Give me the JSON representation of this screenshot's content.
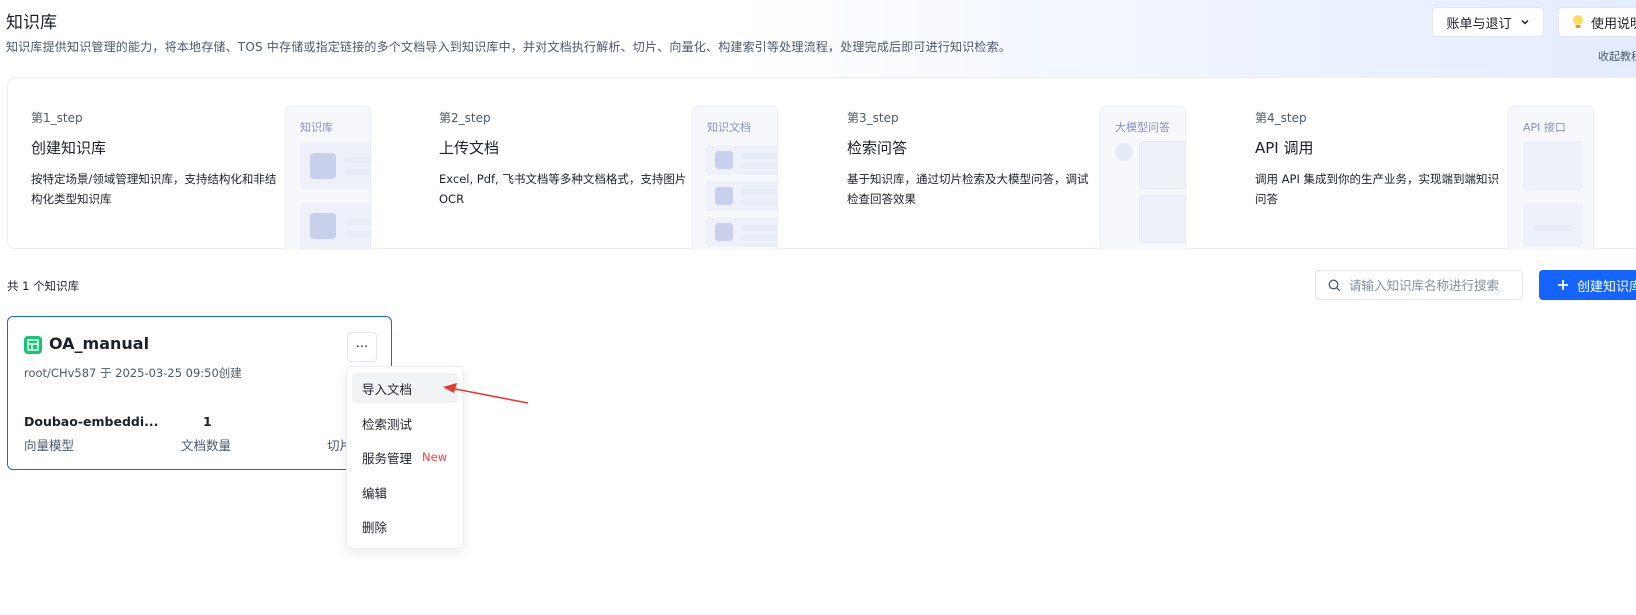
{
  "header": {
    "title": "知识库",
    "description": "知识库提供知识管理的能力，将本地存储、TOS 中存储或指定链接的多个文档导入到知识库中，并对文档执行解析、切片、向量化、构建索引等处理流程，处理完成后即可进行知识检索。",
    "billing_button": "账单与退订",
    "guide_button": "使用说明",
    "collapse_link": "收起教程"
  },
  "steps": [
    {
      "no": "第1_step",
      "title": "创建知识库",
      "desc": "按特定场景/领域管理知识库，支持结构化和非结构化类型知识库",
      "illus_label": "知识库"
    },
    {
      "no": "第2_step",
      "title": "上传文档",
      "desc": "Excel, Pdf, 飞书文档等多种文档格式，支持图片 OCR",
      "illus_label": "知识文档"
    },
    {
      "no": "第3_step",
      "title": "检索问答",
      "desc": "基于知识库，通过切片检索及大模型问答，调试检查回答效果",
      "illus_label": "大模型问答"
    },
    {
      "no": "第4_step",
      "title": "API 调用",
      "desc": "调用 API 集成到你的生产业务，实现端到端知识问答",
      "illus_label": "API 接口"
    }
  ],
  "list": {
    "count_text": "共 1 个知识库",
    "search_placeholder": "请输入知识库名称进行搜索",
    "create_button": "创建知识库"
  },
  "kb_card": {
    "name": "OA_manual",
    "meta": "root/CHv587 于 2025-03-25 09:50创建",
    "more": "···",
    "stats": [
      {
        "value": "Doubao-embeddi...",
        "label": "向量模型"
      },
      {
        "value": "1",
        "label": "文档数量"
      },
      {
        "value": "",
        "label": "切片"
      }
    ]
  },
  "menu": {
    "items": [
      "导入文档",
      "检索测试",
      "服务管理",
      "编辑",
      "删除"
    ],
    "new_badge": "New"
  },
  "colors": {
    "primary": "#1664ff",
    "kb_icon": "#14c477",
    "new_badge": "#f53f3f",
    "arrow": "#e8392f"
  }
}
